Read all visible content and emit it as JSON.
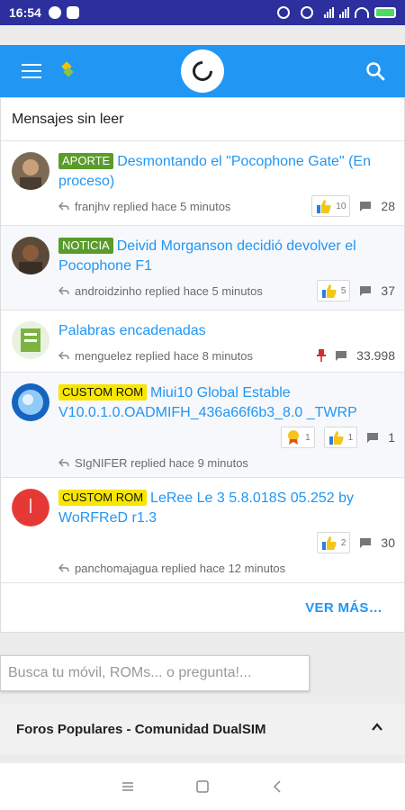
{
  "status_bar": {
    "time": "16:54"
  },
  "header": {
    "section_title": "Mensajes sin leer"
  },
  "threads": [
    {
      "badge": "APORTE",
      "badge_color": "#5a9c2b",
      "title": "Desmontando el \"Pocophone Gate\" (En proceso)",
      "meta": "franjhv replied hace 5 minutos",
      "likes": "10",
      "replies": "28"
    },
    {
      "badge": "NOTICIA",
      "badge_color": "#5a9c2b",
      "title": "Deivid Morganson decidió devolver el Pocophone F1",
      "meta": "androidzinho replied hace 5 minutos",
      "likes": "5",
      "replies": "37"
    },
    {
      "badge": "",
      "title": "Palabras encadenadas",
      "meta": "menguelez replied hace 8 minutos",
      "replies": "33.998",
      "pinned": true
    },
    {
      "badge": "CUSTOM ROM",
      "badge_color": "#f7e600",
      "title": "Miui10 Global Estable V10.0.1.0.OADMIFH_436a66f6b3_8.0 _TWRP",
      "meta": "SIgNIFER replied hace 9 minutos",
      "awards": "1",
      "likes": "1",
      "replies": "1"
    },
    {
      "badge": "CUSTOM ROM",
      "badge_color": "#f7e600",
      "title": "LeRee Le 3 5.8.018S 05.252 by WoRFReD r1.3",
      "meta": "panchomajagua replied hace 12 minutos",
      "likes": "2",
      "replies": "30"
    }
  ],
  "ver_mas_label": "VER MÁS…",
  "search": {
    "placeholder": "Busca tu móvil, ROMs... o pregunta!..."
  },
  "foros": {
    "title": "Foros Populares - Comunidad DualSIM"
  },
  "colors": {
    "appbar": "#2196f3",
    "statusbar": "#2d2f9e",
    "link": "#2196f3"
  }
}
